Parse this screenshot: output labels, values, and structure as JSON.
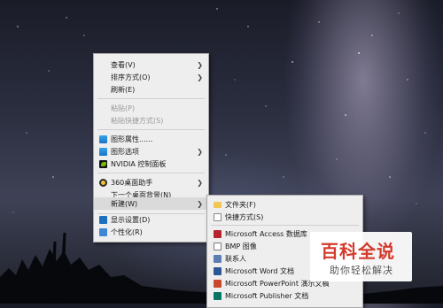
{
  "context_menu": {
    "items": [
      {
        "label": "查看(V)",
        "has_submenu": true,
        "disabled": false
      },
      {
        "label": "排序方式(O)",
        "has_submenu": true,
        "disabled": false
      },
      {
        "label": "刷新(E)",
        "has_submenu": false,
        "disabled": false
      },
      {
        "label": "粘贴(P)",
        "has_submenu": false,
        "disabled": true
      },
      {
        "label": "粘贴快捷方式(S)",
        "has_submenu": false,
        "disabled": true
      },
      {
        "label": "图形属性......",
        "icon": "intel-graphics-icon",
        "disabled": false
      },
      {
        "label": "图形选项",
        "icon": "intel-graphics-icon",
        "has_submenu": true,
        "disabled": false
      },
      {
        "label": "NVIDIA 控制面板",
        "icon": "nvidia-icon",
        "disabled": false
      },
      {
        "label": "360桌面助手",
        "icon": "360-icon",
        "has_submenu": true,
        "disabled": false
      },
      {
        "label": "下一个桌面背景(N)",
        "disabled": false
      },
      {
        "label": "新建(W)",
        "has_submenu": true,
        "highlighted": true,
        "disabled": false
      },
      {
        "label": "显示设置(D)",
        "icon": "display-icon",
        "disabled": false
      },
      {
        "label": "个性化(R)",
        "icon": "personalize-icon",
        "disabled": false
      }
    ]
  },
  "new_submenu": {
    "items": [
      {
        "label": "文件夹(F)",
        "icon": "folder-icon"
      },
      {
        "label": "快捷方式(S)",
        "icon": "shortcut-icon"
      },
      {
        "label": "Microsoft Access 数据库",
        "icon": "access-icon"
      },
      {
        "label": "BMP 图像",
        "icon": "bmp-icon"
      },
      {
        "label": "联系人",
        "icon": "contact-icon"
      },
      {
        "label": "Microsoft Word 文档",
        "icon": "word-icon"
      },
      {
        "label": "Microsoft PowerPoint 演示文稿",
        "icon": "powerpoint-icon"
      },
      {
        "label": "Microsoft Publisher 文档",
        "icon": "publisher-icon"
      }
    ]
  },
  "watermark": {
    "title": "百科全说",
    "subtitle": "助你轻松解决"
  },
  "colors": {
    "menu_bg": "#eeeeee",
    "highlight": "#dadada",
    "disabled_text": "#9a9a9a",
    "watermark_red": "#d43a2b"
  }
}
